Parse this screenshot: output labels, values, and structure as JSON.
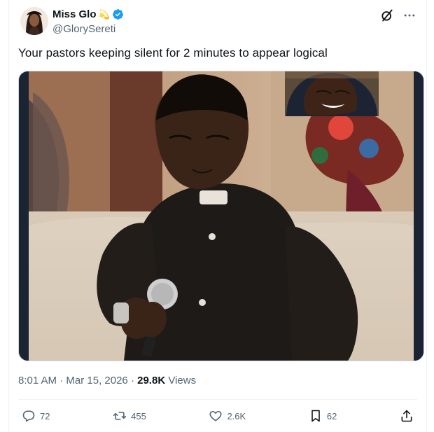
{
  "author": {
    "name": "Miss Glo",
    "handle": "@GlorySereti",
    "verified": true,
    "emoji": "💫"
  },
  "tweet": {
    "text": "Your pastors keeping silent for 2 minutes to appear logical",
    "time": "8:01 AM",
    "date": "Mar 15, 2026",
    "views_count": "29.8K",
    "views_label": "Views"
  },
  "actions": {
    "replies": "72",
    "reposts": "455",
    "likes": "2.6K",
    "bookmarks": "62"
  },
  "colors": {
    "verified": "#1d9bf0",
    "text": "#0f1419",
    "muted": "#536471"
  },
  "icons": [
    "verified-badge-icon",
    "grok-icon",
    "more-icon",
    "reply-icon",
    "repost-icon",
    "like-icon",
    "bookmark-icon",
    "share-icon"
  ]
}
